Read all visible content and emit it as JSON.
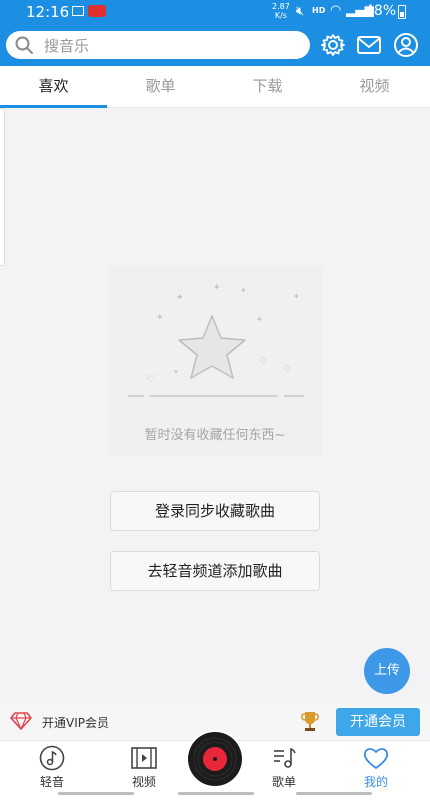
{
  "status": {
    "time": "12:16",
    "speed_top": "2.87",
    "speed_unit": "K/s",
    "hd": "HD",
    "battery": "48%"
  },
  "search": {
    "placeholder": "搜音乐"
  },
  "tabs": [
    {
      "label": "喜欢",
      "active": true
    },
    {
      "label": "歌单"
    },
    {
      "label": "下载"
    },
    {
      "label": "视频"
    }
  ],
  "empty": {
    "message": "暂时没有收藏任何东西~"
  },
  "actions": {
    "login_sync": "登录同步收藏歌曲",
    "add_from_channel": "去轻音频道添加歌曲"
  },
  "upload_label": "上传",
  "vip": {
    "text": "开通VIP会员",
    "button": "开通会员"
  },
  "nav": [
    {
      "label": "轻音",
      "icon": "music-note-icon"
    },
    {
      "label": "视频",
      "icon": "film-icon"
    },
    {
      "label": "歌单",
      "icon": "playlist-icon"
    },
    {
      "label": "我的",
      "icon": "heart-icon",
      "active": true
    }
  ],
  "colors": {
    "primary": "#1d8fe3",
    "accent": "#3da7ea",
    "active_nav": "#3a8ee6"
  }
}
